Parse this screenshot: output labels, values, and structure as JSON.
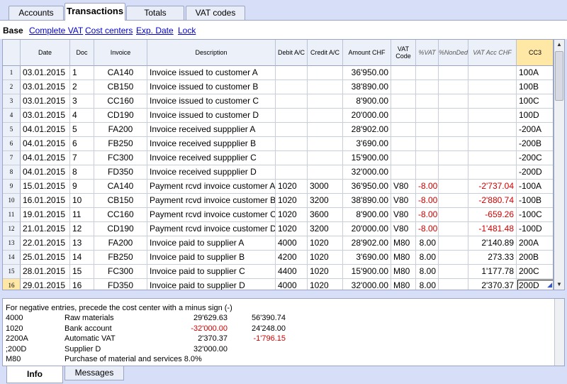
{
  "tabs": [
    {
      "label": "Accounts"
    },
    {
      "label": "Transactions",
      "active": true
    },
    {
      "label": "Totals"
    },
    {
      "label": "VAT codes"
    }
  ],
  "toolbar": {
    "base": "Base",
    "items": [
      "Complete VAT",
      "Cost centers",
      "Exp. Date",
      "Lock"
    ]
  },
  "columns": [
    "Date",
    "Doc",
    "Invoice",
    "Description",
    "Debit A/C",
    "Credit A/C",
    "Amount CHF",
    "VAT Code",
    "%VAT",
    "%NonDed",
    "VAT Acc CHF",
    "CC3"
  ],
  "rows": [
    {
      "n": "1",
      "date": "03.01.2015",
      "doc": "1",
      "inv": "CA140",
      "desc": "Invoice issued to customer A",
      "debit": "",
      "credit": "",
      "amount": "36'950.00",
      "vatcode": "",
      "pvat": "",
      "nonded": "",
      "vatacc": "",
      "cc3": "100A"
    },
    {
      "n": "2",
      "date": "03.01.2015",
      "doc": "2",
      "inv": "CB150",
      "desc": "Invoice issued to customer B",
      "debit": "",
      "credit": "",
      "amount": "38'890.00",
      "vatcode": "",
      "pvat": "",
      "nonded": "",
      "vatacc": "",
      "cc3": "100B"
    },
    {
      "n": "3",
      "date": "03.01.2015",
      "doc": "3",
      "inv": "CC160",
      "desc": "Invoice issued to customer C",
      "debit": "",
      "credit": "",
      "amount": "8'900.00",
      "vatcode": "",
      "pvat": "",
      "nonded": "",
      "vatacc": "",
      "cc3": "100C"
    },
    {
      "n": "4",
      "date": "03.01.2015",
      "doc": "4",
      "inv": "CD190",
      "desc": "Invoice issued to customer D",
      "debit": "",
      "credit": "",
      "amount": "20'000.00",
      "vatcode": "",
      "pvat": "",
      "nonded": "",
      "vatacc": "",
      "cc3": "100D"
    },
    {
      "n": "5",
      "date": "04.01.2015",
      "doc": "5",
      "inv": "FA200",
      "desc": "Invoice received suppplier A",
      "debit": "",
      "credit": "",
      "amount": "28'902.00",
      "vatcode": "",
      "pvat": "",
      "nonded": "",
      "vatacc": "",
      "cc3": "-200A"
    },
    {
      "n": "6",
      "date": "04.01.2015",
      "doc": "6",
      "inv": "FB250",
      "desc": "Invoice received suppplier B",
      "debit": "",
      "credit": "",
      "amount": "3'690.00",
      "vatcode": "",
      "pvat": "",
      "nonded": "",
      "vatacc": "",
      "cc3": "-200B"
    },
    {
      "n": "7",
      "date": "04.01.2015",
      "doc": "7",
      "inv": "FC300",
      "desc": "Invoice received suppplier C",
      "debit": "",
      "credit": "",
      "amount": "15'900.00",
      "vatcode": "",
      "pvat": "",
      "nonded": "",
      "vatacc": "",
      "cc3": "-200C"
    },
    {
      "n": "8",
      "date": "04.01.2015",
      "doc": "8",
      "inv": "FD350",
      "desc": "Invoice received suppplier D",
      "debit": "",
      "credit": "",
      "amount": "32'000.00",
      "vatcode": "",
      "pvat": "",
      "nonded": "",
      "vatacc": "",
      "cc3": "-200D"
    },
    {
      "n": "9",
      "date": "15.01.2015",
      "doc": "9",
      "inv": "CA140",
      "desc": "Payment rcvd invoice customer A",
      "debit": "1020",
      "credit": "3000",
      "amount": "36'950.00",
      "vatcode": "V80",
      "pvat": "-8.00",
      "nonded": "",
      "vatacc": "-2'737.04",
      "cc3": "-100A",
      "neg": true
    },
    {
      "n": "10",
      "date": "16.01.2015",
      "doc": "10",
      "inv": "CB150",
      "desc": "Payment rcvd invoice customer B",
      "debit": "1020",
      "credit": "3200",
      "amount": "38'890.00",
      "vatcode": "V80",
      "pvat": "-8.00",
      "nonded": "",
      "vatacc": "-2'880.74",
      "cc3": "-100B",
      "neg": true
    },
    {
      "n": "11",
      "date": "19.01.2015",
      "doc": "11",
      "inv": "CC160",
      "desc": "Payment rcvd invoice customer C",
      "debit": "1020",
      "credit": "3600",
      "amount": "8'900.00",
      "vatcode": "V80",
      "pvat": "-8.00",
      "nonded": "",
      "vatacc": "-659.26",
      "cc3": "-100C",
      "neg": true
    },
    {
      "n": "12",
      "date": "21.01.2015",
      "doc": "12",
      "inv": "CD190",
      "desc": "Payment rcvd invoice customer D",
      "debit": "1020",
      "credit": "3200",
      "amount": "20'000.00",
      "vatcode": "V80",
      "pvat": "-8.00",
      "nonded": "",
      "vatacc": "-1'481.48",
      "cc3": "-100D",
      "neg": true
    },
    {
      "n": "13",
      "date": "22.01.2015",
      "doc": "13",
      "inv": "FA200",
      "desc": "Invoice paid to supplier A",
      "debit": "4000",
      "credit": "1020",
      "amount": "28'902.00",
      "vatcode": "M80",
      "pvat": "8.00",
      "nonded": "",
      "vatacc": "2'140.89",
      "cc3": "200A"
    },
    {
      "n": "14",
      "date": "25.01.2015",
      "doc": "14",
      "inv": "FB250",
      "desc": "Invoice paid to supplier B",
      "debit": "4200",
      "credit": "1020",
      "amount": "3'690.00",
      "vatcode": "M80",
      "pvat": "8.00",
      "nonded": "",
      "vatacc": "273.33",
      "cc3": "200B"
    },
    {
      "n": "15",
      "date": "28.01.2015",
      "doc": "15",
      "inv": "FC300",
      "desc": "Invoice paid to supplier C",
      "debit": "4400",
      "credit": "1020",
      "amount": "15'900.00",
      "vatcode": "M80",
      "pvat": "8.00",
      "nonded": "",
      "vatacc": "1'177.78",
      "cc3": "200C"
    },
    {
      "n": "16",
      "date": "29.01.2015",
      "doc": "16",
      "inv": "FD350",
      "desc": "Invoice paid to supplier D",
      "debit": "4000",
      "credit": "1020",
      "amount": "32'000.00",
      "vatcode": "M80",
      "pvat": "8.00",
      "nonded": "",
      "vatacc": "2'370.37",
      "cc3": "200D",
      "selected": true
    }
  ],
  "info": {
    "hint": "For negative entries, precede the cost center with a minus sign (-)",
    "lines": [
      {
        "code": "4000",
        "name": "Raw materials",
        "v1": "29'629.63",
        "v2": "56'390.74",
        "v1red": false,
        "v2red": false
      },
      {
        "code": "1020",
        "name": "Bank account",
        "v1": "-32'000.00",
        "v2": "24'248.00",
        "v1red": true,
        "v2red": false
      },
      {
        "code": "2200A",
        "name": "Automatic VAT",
        "v1": "2'370.37",
        "v2": "-1'796.15",
        "v1red": false,
        "v2red": true
      },
      {
        "code": ";200D",
        "name": "Supplier D",
        "v1": "32'000.00",
        "v2": "",
        "v1red": false,
        "v2red": false
      },
      {
        "code": "M80",
        "name": "Purchase of material and services 8.0%",
        "v1": "",
        "v2": "",
        "v1red": false,
        "v2red": false
      }
    ]
  },
  "bottom_tabs": [
    {
      "label": "Info",
      "active": true
    },
    {
      "label": "Messages"
    }
  ]
}
